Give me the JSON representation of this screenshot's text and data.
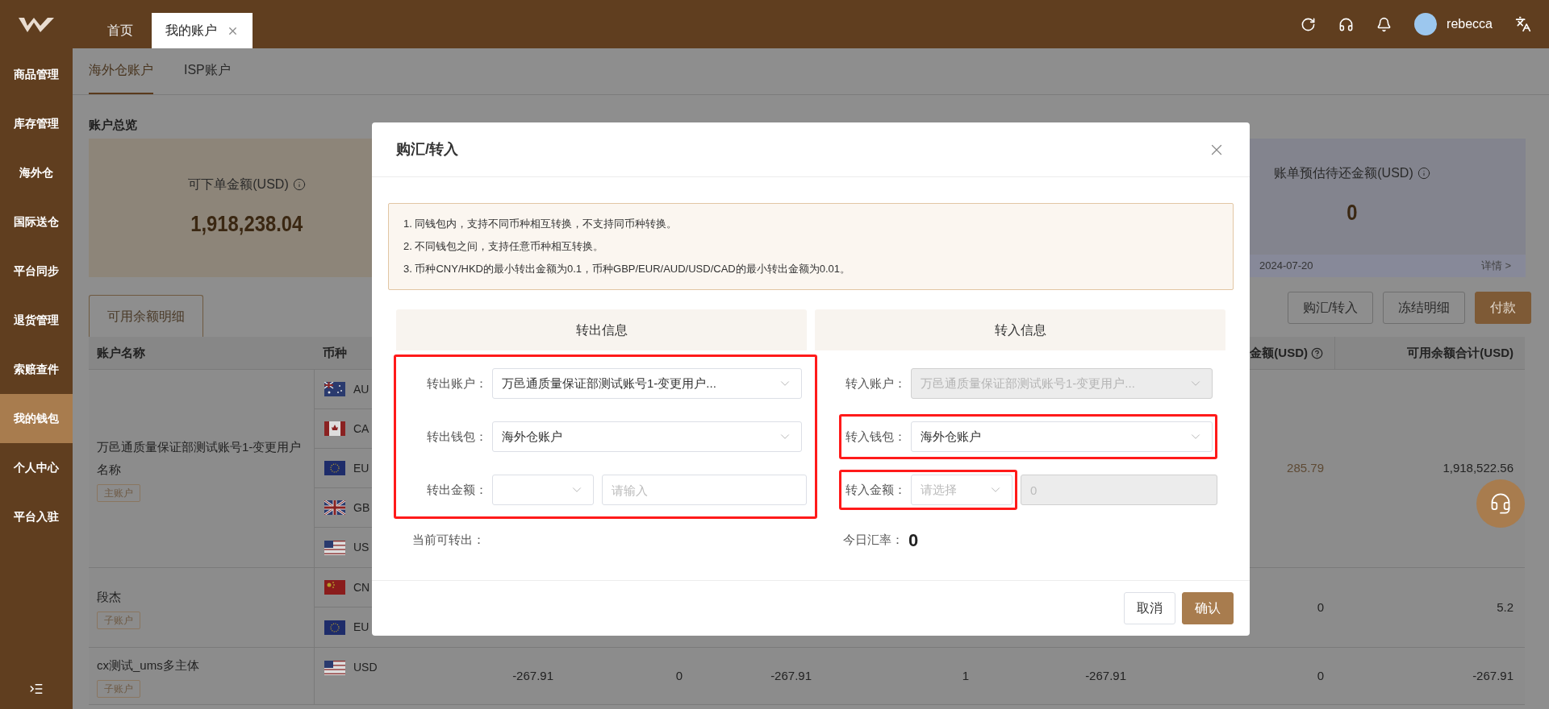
{
  "sidebar": {
    "items": [
      {
        "label": "商品管理",
        "selected": false
      },
      {
        "label": "库存管理",
        "selected": false
      },
      {
        "label": "海外仓",
        "selected": false
      },
      {
        "label": "国际送仓",
        "selected": false
      },
      {
        "label": "平台同步",
        "selected": false
      },
      {
        "label": "退货管理",
        "selected": false
      },
      {
        "label": "索赔查件",
        "selected": false
      },
      {
        "label": "我的钱包",
        "selected": true
      },
      {
        "label": "个人中心",
        "selected": false
      },
      {
        "label": "平台入驻",
        "selected": false
      }
    ]
  },
  "header": {
    "tabs": [
      {
        "label": "首页",
        "selected": false,
        "closable": false
      },
      {
        "label": "我的账户",
        "selected": true,
        "closable": true
      }
    ],
    "user": "rebecca"
  },
  "page_tabs": [
    {
      "label": "海外仓账户",
      "selected": true
    },
    {
      "label": "ISP账户",
      "selected": false
    }
  ],
  "overview": {
    "title": "账户总览",
    "cards": [
      {
        "label": "可下单金额(USD)",
        "value": "1,918,238.04"
      },
      {
        "label": "账单预估待还金额(USD)",
        "value": "0",
        "date": "2024-07-20",
        "link": "详情 >"
      }
    ]
  },
  "detail_tab": {
    "label": "可用余额明细"
  },
  "actions": [
    {
      "label": "购汇/转入",
      "kind": "default"
    },
    {
      "label": "冻结明细",
      "kind": "default"
    },
    {
      "label": "付款",
      "kind": "primary"
    }
  ],
  "table": {
    "columns": [
      {
        "title": "账户名称"
      },
      {
        "title": "币种"
      }
    ],
    "end_columns": [
      {
        "title": "金额(USD)",
        "help": true
      },
      {
        "title": "可用余额合计(USD)",
        "help": false
      }
    ],
    "groups": [
      {
        "name": "万邑通质量保证部测试账号1-变更用户名称",
        "badge": "主账户",
        "currencies": [
          {
            "code": "AU",
            "kind": "au"
          },
          {
            "code": "CA",
            "kind": "ca"
          },
          {
            "code": "EU",
            "kind": "eu"
          },
          {
            "code": "GB",
            "kind": "gb"
          },
          {
            "code": "US",
            "kind": "us"
          }
        ],
        "values": [
          {
            "text": "285.79",
            "link": true
          },
          {
            "text": "1,918,522.56",
            "link": false
          }
        ]
      },
      {
        "name": "段杰",
        "badge": "子账户",
        "currencies": [
          {
            "code": "CN",
            "kind": "cn"
          },
          {
            "code": "EU",
            "kind": "eu"
          }
        ],
        "values": [
          {
            "text": "0",
            "link": false
          },
          {
            "text": "5.2",
            "link": false
          }
        ]
      },
      {
        "name": "cx测试_ums多主体",
        "badge": "子账户",
        "currencies": [
          {
            "code": "USD",
            "kind": "us"
          }
        ],
        "values": [
          {
            "text": "-267.91",
            "link": false
          },
          {
            "text": "0",
            "link": false
          },
          {
            "text": "-267.91",
            "link": false
          },
          {
            "text": "1",
            "link": false
          },
          {
            "text": "-267.91",
            "link": false
          },
          {
            "text": "0",
            "link": false
          },
          {
            "text": "-267.91",
            "link": false
          }
        ]
      }
    ]
  },
  "dialog": {
    "title": "购汇/转入",
    "notices": [
      "1. 同钱包内，支持不同币种相互转换，不支持同币种转换。",
      "2. 不同钱包之间，支持任意币种相互转换。",
      "3. 币种CNY/HKD的最小转出金额为0.1，币种GBP/EUR/AUD/USD/CAD的最小转出金额为0.01。"
    ],
    "sections": [
      {
        "title": "转出信息",
        "highlighted": true,
        "fields": [
          {
            "kind": "select",
            "label": "转出账户：",
            "value": "万邑通质量保证部测试账号1-变更用户...",
            "disabled": false,
            "highlighted": false
          },
          {
            "kind": "select",
            "label": "转出钱包：",
            "value": "海外仓账户",
            "disabled": false,
            "highlighted": false
          },
          {
            "kind": "amount",
            "label": "转出金额：",
            "select": {
              "disabled": false
            },
            "input": {
              "placeholder": "请输入",
              "disabled": false
            },
            "highlighted": false
          }
        ],
        "info": {
          "label": "当前可转出："
        }
      },
      {
        "title": "转入信息",
        "highlighted": false,
        "fields": [
          {
            "kind": "select",
            "label": "转入账户：",
            "value": "万邑通质量保证部测试账号1-变更用户...",
            "disabled": true,
            "highlighted": false
          },
          {
            "kind": "select",
            "label": "转入钱包：",
            "value": "海外仓账户",
            "disabled": false,
            "highlighted": true
          },
          {
            "kind": "amount",
            "label": "转入金额：",
            "select": {
              "placeholder": "请选择",
              "disabled": false
            },
            "input": {
              "value": "0",
              "disabled": true
            },
            "highlighted": true
          }
        ],
        "info": {
          "label": "今日汇率：",
          "value": "0"
        }
      }
    ],
    "buttons": [
      {
        "label": "取消",
        "kind": "default"
      },
      {
        "label": "确认",
        "kind": "primary"
      }
    ]
  }
}
